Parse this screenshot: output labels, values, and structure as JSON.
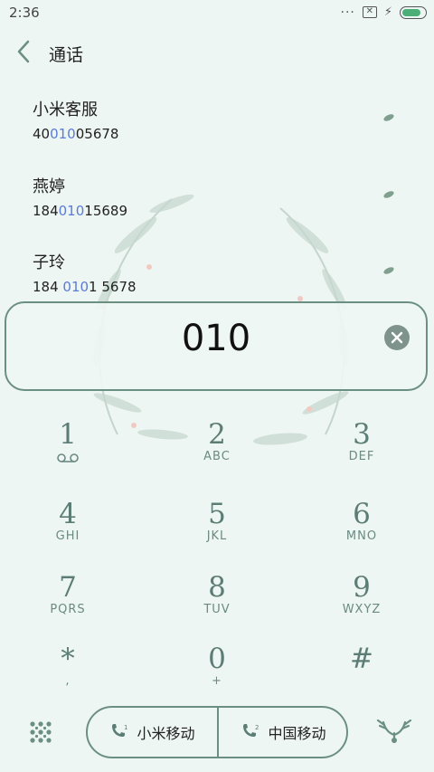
{
  "status": {
    "time": "2:36"
  },
  "header": {
    "title": "通话"
  },
  "contacts": [
    {
      "name": "小米客服",
      "number_pre": "40",
      "number_hl": "010",
      "number_post": "05678"
    },
    {
      "name": "燕婷",
      "number_pre": "184",
      "number_hl": "010",
      "number_post": "15689"
    },
    {
      "name": "子玲",
      "number_pre": "184 ",
      "number_hl": "010",
      "number_post": "1 5678"
    }
  ],
  "input": {
    "value": "010"
  },
  "keypad": [
    {
      "digit": "1",
      "letters": ""
    },
    {
      "digit": "2",
      "letters": "ABC"
    },
    {
      "digit": "3",
      "letters": "DEF"
    },
    {
      "digit": "4",
      "letters": "GHI"
    },
    {
      "digit": "5",
      "letters": "JKL"
    },
    {
      "digit": "6",
      "letters": "MNO"
    },
    {
      "digit": "7",
      "letters": "PQRS"
    },
    {
      "digit": "8",
      "letters": "TUV"
    },
    {
      "digit": "9",
      "letters": "WXYZ"
    },
    {
      "digit": "*",
      "letters": ","
    },
    {
      "digit": "0",
      "letters": "+"
    },
    {
      "digit": "#",
      "letters": ""
    }
  ],
  "call_buttons": [
    {
      "sim": "1",
      "label": "小米移动"
    },
    {
      "sim": "2",
      "label": "中国移动"
    }
  ],
  "icons": {
    "status": [
      "more-dots-icon",
      "sim-missing-icon",
      "charging-bolt-icon",
      "battery-icon"
    ],
    "back": "back-arrow-icon",
    "voicemail": "voicemail-icon",
    "clear": "clear-input-icon",
    "dialpad_toggle": "dialpad-grid-icon",
    "theme": "antler-icon",
    "call": "phone-sim-icon"
  },
  "battery_level": 0.85,
  "colors": {
    "accent": "#6c8f84",
    "highlight": "#5b7bd6",
    "background": "#eef6f3"
  }
}
